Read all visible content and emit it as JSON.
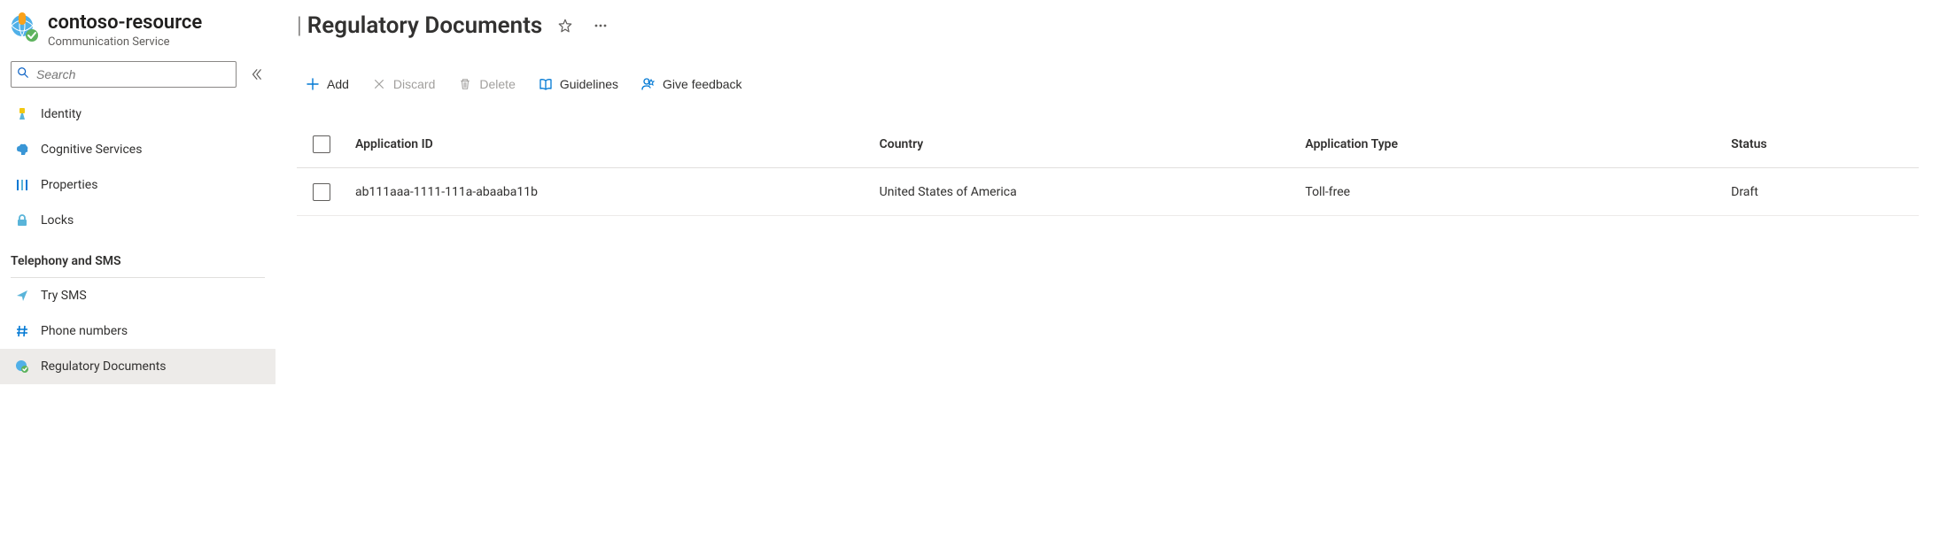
{
  "resource": {
    "name": "contoso-resource",
    "service_type": "Communication Service"
  },
  "search": {
    "placeholder": "Search"
  },
  "sidebar": {
    "items": [
      {
        "label": "Identity",
        "icon": "identity",
        "active": false
      },
      {
        "label": "Cognitive Services",
        "icon": "cognitive",
        "active": false
      },
      {
        "label": "Properties",
        "icon": "properties",
        "active": false
      },
      {
        "label": "Locks",
        "icon": "locks",
        "active": false
      }
    ],
    "section2_title": "Telephony and SMS",
    "section2_items": [
      {
        "label": "Try SMS",
        "icon": "trysms",
        "active": false
      },
      {
        "label": "Phone numbers",
        "icon": "hash",
        "active": false
      },
      {
        "label": "Regulatory Documents",
        "icon": "regulatory",
        "active": true
      }
    ]
  },
  "page": {
    "title": "Regulatory Documents"
  },
  "toolbar": {
    "add": "Add",
    "discard": "Discard",
    "delete": "Delete",
    "guidelines": "Guidelines",
    "feedback": "Give feedback"
  },
  "table": {
    "headers": {
      "application_id": "Application ID",
      "country": "Country",
      "application_type": "Application Type",
      "status": "Status"
    },
    "rows": [
      {
        "application_id": "ab111aaa-1111-111a-abaaba11b",
        "country": "United States of America",
        "application_type": "Toll-free",
        "status": "Draft"
      }
    ]
  }
}
